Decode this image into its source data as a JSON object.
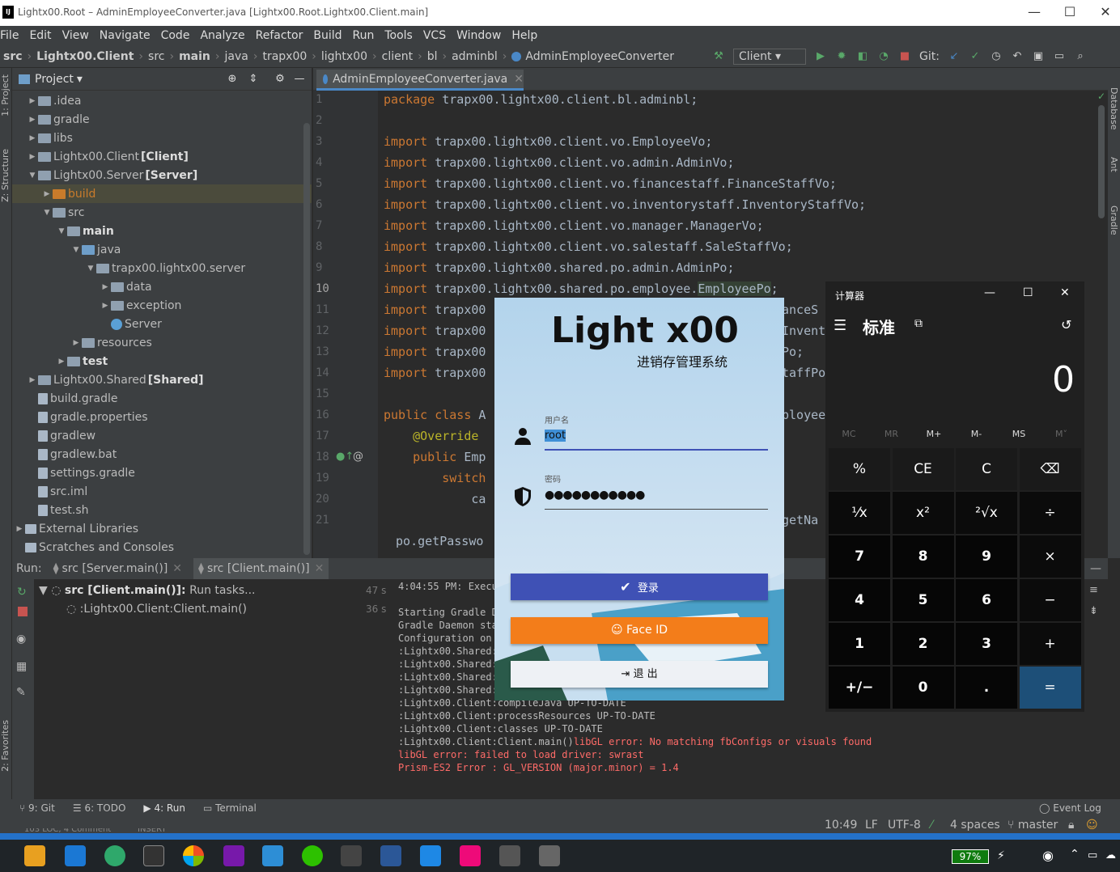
{
  "titlebar": {
    "logo": "IJ",
    "title": "Lightx00.Root – AdminEmployeeConverter.java [Lightx00.Root.Lightx00.Client.main]",
    "minimize": "—",
    "maximize": "☐",
    "close": "✕"
  },
  "menu": [
    "File",
    "Edit",
    "View",
    "Navigate",
    "Code",
    "Analyze",
    "Refactor",
    "Build",
    "Run",
    "Tools",
    "VCS",
    "Window",
    "Help"
  ],
  "breadcrumbs": [
    "src",
    "Lightx00.Client",
    "src",
    "main",
    "java",
    "trapx00",
    "lightx00",
    "client",
    "bl",
    "adminbl",
    "AdminEmployeeConverter"
  ],
  "run_config": "Client",
  "git_label": "Git:",
  "side_tabs": {
    "project": "1: Project",
    "structure": "Z: Structure",
    "favorites": "2: Favorites",
    "database": "Database",
    "ant": "Ant",
    "gradle": "Gradle"
  },
  "project_panel": {
    "title": "Project",
    "items": [
      {
        "label": ".idea",
        "suffix": "",
        "arrow": "▶",
        "indent": 0,
        "icon": "folder"
      },
      {
        "label": "gradle",
        "suffix": "",
        "arrow": "▶",
        "indent": 0,
        "icon": "folder"
      },
      {
        "label": "libs",
        "suffix": "",
        "arrow": "▶",
        "indent": 0,
        "icon": "folder"
      },
      {
        "label": "Lightx00.Client",
        "suffix": "[Client]",
        "arrow": "▶",
        "indent": 0,
        "icon": "folder"
      },
      {
        "label": "Lightx00.Server",
        "suffix": "[Server]",
        "arrow": "▼",
        "indent": 0,
        "icon": "folder"
      },
      {
        "label": "build",
        "suffix": "",
        "arrow": "▶",
        "indent": 1,
        "icon": "folder-orange"
      },
      {
        "label": "src",
        "suffix": "",
        "arrow": "▼",
        "indent": 1,
        "icon": "folder"
      },
      {
        "label": "main",
        "suffix": "",
        "arrow": "▼",
        "indent": 2,
        "icon": "folder"
      },
      {
        "label": "java",
        "suffix": "",
        "arrow": "▼",
        "indent": 3,
        "icon": "folder-blue"
      },
      {
        "label": "trapx00.lightx00.server",
        "suffix": "",
        "arrow": "▼",
        "indent": 4,
        "icon": "folder"
      },
      {
        "label": "data",
        "suffix": "",
        "arrow": "▶",
        "indent": 5,
        "icon": "folder"
      },
      {
        "label": "exception",
        "suffix": "",
        "arrow": "▶",
        "indent": 5,
        "icon": "folder"
      },
      {
        "label": "Server",
        "suffix": "",
        "arrow": "",
        "indent": 5,
        "icon": "class"
      },
      {
        "label": "resources",
        "suffix": "",
        "arrow": "▶",
        "indent": 3,
        "icon": "folder"
      },
      {
        "label": "test",
        "suffix": "",
        "arrow": "▶",
        "indent": 2,
        "icon": "folder"
      },
      {
        "label": "Lightx00.Shared",
        "suffix": "[Shared]",
        "arrow": "▶",
        "indent": 0,
        "icon": "folder"
      },
      {
        "label": "build.gradle",
        "suffix": "",
        "arrow": "",
        "indent": 0,
        "icon": "file"
      },
      {
        "label": "gradle.properties",
        "suffix": "",
        "arrow": "",
        "indent": 0,
        "icon": "file"
      },
      {
        "label": "gradlew",
        "suffix": "",
        "arrow": "",
        "indent": 0,
        "icon": "file"
      },
      {
        "label": "gradlew.bat",
        "suffix": "",
        "arrow": "",
        "indent": 0,
        "icon": "file"
      },
      {
        "label": "settings.gradle",
        "suffix": "",
        "arrow": "",
        "indent": 0,
        "icon": "file"
      },
      {
        "label": "src.iml",
        "suffix": "",
        "arrow": "",
        "indent": 0,
        "icon": "file"
      },
      {
        "label": "test.sh",
        "suffix": "",
        "arrow": "",
        "indent": 0,
        "icon": "file"
      },
      {
        "label": "External Libraries",
        "suffix": "",
        "arrow": "▶",
        "indent": -1,
        "icon": "lib"
      },
      {
        "label": "Scratches and Consoles",
        "suffix": "",
        "arrow": "",
        "indent": -1,
        "icon": "scratch"
      }
    ]
  },
  "editor": {
    "tab": "AdminEmployeeConverter.java",
    "line_numbers": [
      "1",
      "2",
      "3",
      "4",
      "5",
      "6",
      "7",
      "8",
      "9",
      "10",
      "11",
      "12",
      "13",
      "14",
      "15",
      "16",
      "17",
      "18",
      "19",
      "20",
      "21"
    ],
    "lines": [
      {
        "kw": "package ",
        "rest": "trapx00.lightx00.client.bl.adminbl;"
      },
      {
        "kw": "",
        "rest": ""
      },
      {
        "kw": "import ",
        "rest": "trapx00.lightx00.client.vo.EmployeeVo;"
      },
      {
        "kw": "import ",
        "rest": "trapx00.lightx00.client.vo.admin.AdminVo;"
      },
      {
        "kw": "import ",
        "rest": "trapx00.lightx00.client.vo.financestaff.FinanceStaffVo;"
      },
      {
        "kw": "import ",
        "rest": "trapx00.lightx00.client.vo.inventorystaff.InventoryStaffVo;"
      },
      {
        "kw": "import ",
        "rest": "trapx00.lightx00.client.vo.manager.ManagerVo;"
      },
      {
        "kw": "import ",
        "rest": "trapx00.lightx00.client.vo.salestaff.SaleStaffVo;"
      },
      {
        "kw": "import ",
        "rest": "trapx00.lightx00.shared.po.admin.AdminPo;"
      },
      {
        "kw": "import ",
        "rest": "trapx00.lightx00.shared.po.employee.",
        "hl": "EmployeePo",
        "tail": ";"
      },
      {
        "kw": "import ",
        "rest": "trapx00",
        "right": "anceS"
      },
      {
        "kw": "import ",
        "rest": "trapx00",
        "right": "Invent"
      },
      {
        "kw": "import ",
        "rest": "trapx00",
        "right": "Po;"
      },
      {
        "kw": "import ",
        "rest": "trapx00",
        "right": "taffPo"
      },
      {
        "kw": "",
        "rest": ""
      },
      {
        "kw": "public class ",
        "rest": "A",
        "right": "ployee"
      },
      {
        "kw": "    ",
        "ann": "@Override",
        "rest": ""
      },
      {
        "kw": "    public ",
        "rest": "Emp"
      },
      {
        "kw": "        switch",
        "rest": ""
      },
      {
        "kw": "",
        "rest": "            ca"
      },
      {
        "kw": "",
        "rest": "",
        "right": "getNa"
      }
    ],
    "last_partial": " po.getPasswo"
  },
  "run": {
    "label": "Run:",
    "tabs": [
      "src [Server.main()]",
      "src [Client.main()]"
    ],
    "tree": [
      {
        "label": "src [Client.main()]:",
        "rest": " Run tasks...",
        "time": "47 s"
      },
      {
        "label": ":Lightx00.Client:Client.main()",
        "rest": "",
        "time": "36 s"
      }
    ],
    "console": [
      {
        "text": "4:04:55 PM: Execu",
        "err": false
      },
      {
        "text": "",
        "err": false
      },
      {
        "text": "Starting Gradle D",
        "err": false
      },
      {
        "text": "Gradle Daemon sta",
        "err": false
      },
      {
        "text": "Configuration on",
        "err": false
      },
      {
        "text": ":Lightx00.Shared:",
        "err": false
      },
      {
        "text": ":Lightx00.Shared:",
        "err": false
      },
      {
        "text": ":Lightx00.Shared:",
        "err": false
      },
      {
        "text": ":Lightx00.Shared:",
        "err": false
      },
      {
        "text": ":Lightx00.Client:compileJava UP-TO-DATE",
        "err": false
      },
      {
        "text": ":Lightx00.Client:processResources UP-TO-DATE",
        "err": false
      },
      {
        "text": ":Lightx00.Client:classes UP-TO-DATE",
        "err": false
      },
      {
        "text": ":Lightx00.Client:Client.main()",
        "err": false,
        "errtail": "libGL error: No matching fbConfigs or visuals found"
      },
      {
        "text": "libGL error: failed to load driver: swrast",
        "err": true
      },
      {
        "text": "Prism-ES2 Error : GL_VERSION (major.minor) = 1.4",
        "err": true
      }
    ]
  },
  "bottom_tools": [
    "9: Git",
    "6: TODO",
    "4: Run",
    "Terminal"
  ],
  "event_log": "Event Log",
  "status": {
    "position": "10:49",
    "line_sep": "LF",
    "encoding": "UTF-8",
    "indent": "4 spaces",
    "branch": "master",
    "left_partial": "103 LOC, 4 Comment",
    "insert": "INSERT"
  },
  "login": {
    "title": "Light x00",
    "subtitle": "进销存管理系统",
    "username_label": "用户名",
    "username_value": "root",
    "password_label": "密码",
    "password_value": "●●●●●●●●●●●",
    "login_button": "登录",
    "faceid_button": "Face ID",
    "exit_button": "退 出"
  },
  "calculator": {
    "title": "计算器",
    "mode": "标准",
    "display": "0",
    "memory": [
      "MC",
      "MR",
      "M+",
      "M-",
      "MS",
      "M˅"
    ],
    "keys": [
      "%",
      "CE",
      "C",
      "⌫",
      "¹⁄x",
      "x²",
      "²√x",
      "÷",
      "7",
      "8",
      "9",
      "×",
      "4",
      "5",
      "6",
      "−",
      "1",
      "2",
      "3",
      "+",
      "+/−",
      "0",
      ".",
      "="
    ]
  },
  "taskbar": {
    "battery": "97%"
  }
}
